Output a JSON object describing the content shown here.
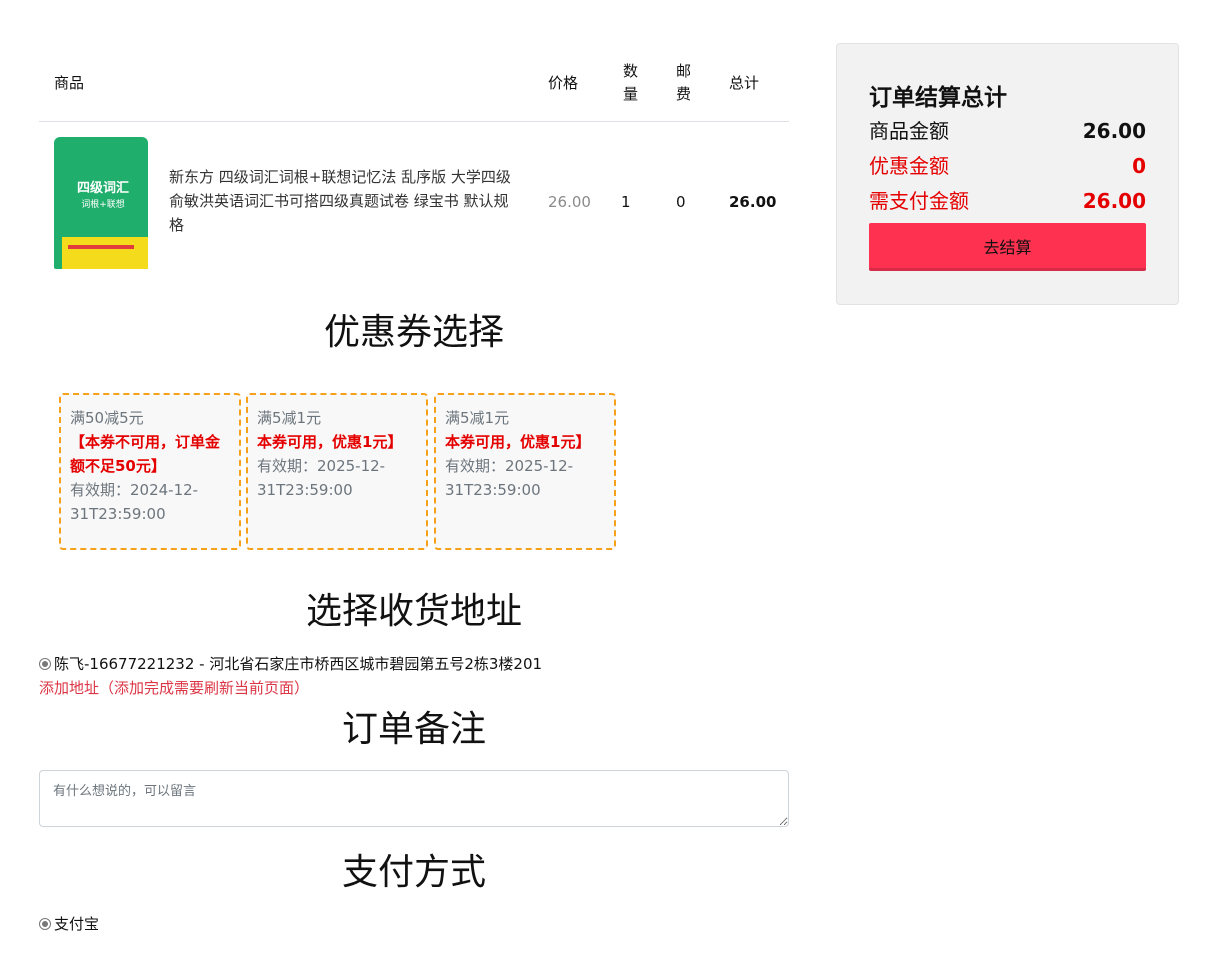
{
  "cart": {
    "headers": {
      "product": "商品",
      "price": "价格",
      "quantity": "数量",
      "shipping": "邮费",
      "total": "总计"
    },
    "items": [
      {
        "image_icon": "book-cover-image",
        "name": "新东方 四级词汇词根+联想记忆法 乱序版 大学四级俞敏洪英语词汇书可搭四级真题试卷 绿宝书 默认规格",
        "price": "26.00",
        "quantity": "1",
        "shipping": "0",
        "total": "26.00"
      }
    ]
  },
  "coupon_section": {
    "title": "优惠券选择",
    "coupons": [
      {
        "condition": "满50减5元",
        "status": "【本券不可用，订单金额不足50元】",
        "expiry": "有效期：2024-12-31T23:59:00"
      },
      {
        "condition": "满5减1元",
        "status": "本券可用，优惠1元】",
        "expiry": "有效期：2025-12-31T23:59:00"
      },
      {
        "condition": "满5减1元",
        "status": "本券可用，优惠1元】",
        "expiry": "有效期：2025-12-31T23:59:00"
      }
    ]
  },
  "address_section": {
    "title": "选择收货地址",
    "selected_address": "陈飞-16677221232 - 河北省石家庄市桥西区城市碧园第五号2栋3楼201",
    "add_link": "添加地址（添加完成需要刷新当前页面）"
  },
  "note_section": {
    "title": "订单备注",
    "placeholder": "有什么想说的，可以留言"
  },
  "payment_section": {
    "title": "支付方式",
    "method": "支付宝"
  },
  "summary": {
    "title": "订单结算总计",
    "goods_amount_label": "商品金额",
    "goods_amount": "26.00",
    "discount_label": "优惠金额",
    "discount": "0",
    "payable_label": "需支付金额",
    "payable": "26.00",
    "checkout_label": "去结算"
  },
  "colors": {
    "accent_red": "#e50000",
    "checkout_button": "#ff3151",
    "coupon_border": "#f6a11a",
    "link_red": "#dc3545"
  }
}
